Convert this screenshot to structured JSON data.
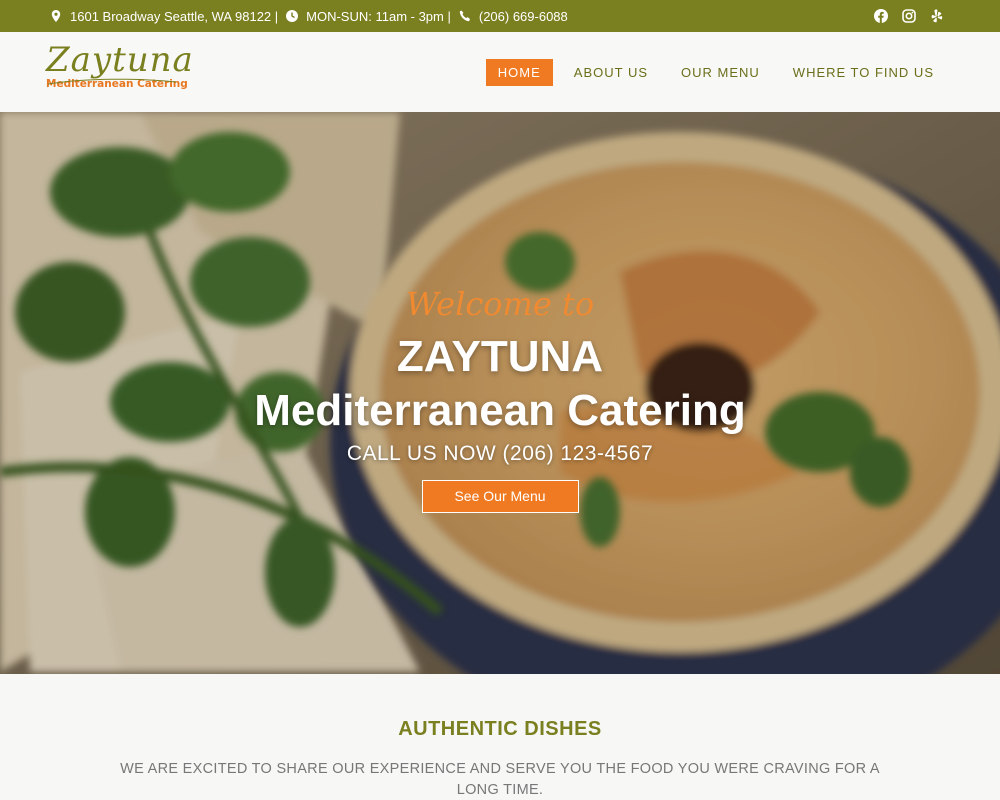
{
  "topbar": {
    "address": "1601 Broadway Seattle, WA 98122 |",
    "hours": "MON-SUN: 11am - 3pm |",
    "phone": "(206) 669-6088",
    "social": [
      "facebook-icon",
      "instagram-icon",
      "yelp-icon"
    ]
  },
  "header": {
    "logo_script": "Zaytuna",
    "logo_sub": "Mediterranean Catering",
    "nav": [
      {
        "label": "HOME",
        "active": true
      },
      {
        "label": "ABOUT US",
        "active": false
      },
      {
        "label": "OUR MENU",
        "active": false
      },
      {
        "label": "WHERE TO FIND US",
        "active": false
      }
    ]
  },
  "hero": {
    "welcome": "Welcome to",
    "title_line1": "ZAYTUNA",
    "title_line2": "Mediterranean Catering",
    "phone_cta": "CALL US NOW (206) 123-4567",
    "button": "See Our Menu"
  },
  "section": {
    "title": "AUTHENTIC DISHES",
    "description": "WE ARE EXCITED TO SHARE OUR EXPERIENCE AND SERVE YOU THE FOOD YOU WERE CRAVING FOR A LONG TIME."
  },
  "colors": {
    "olive": "#7a7f1f",
    "orange": "#f07a22"
  }
}
